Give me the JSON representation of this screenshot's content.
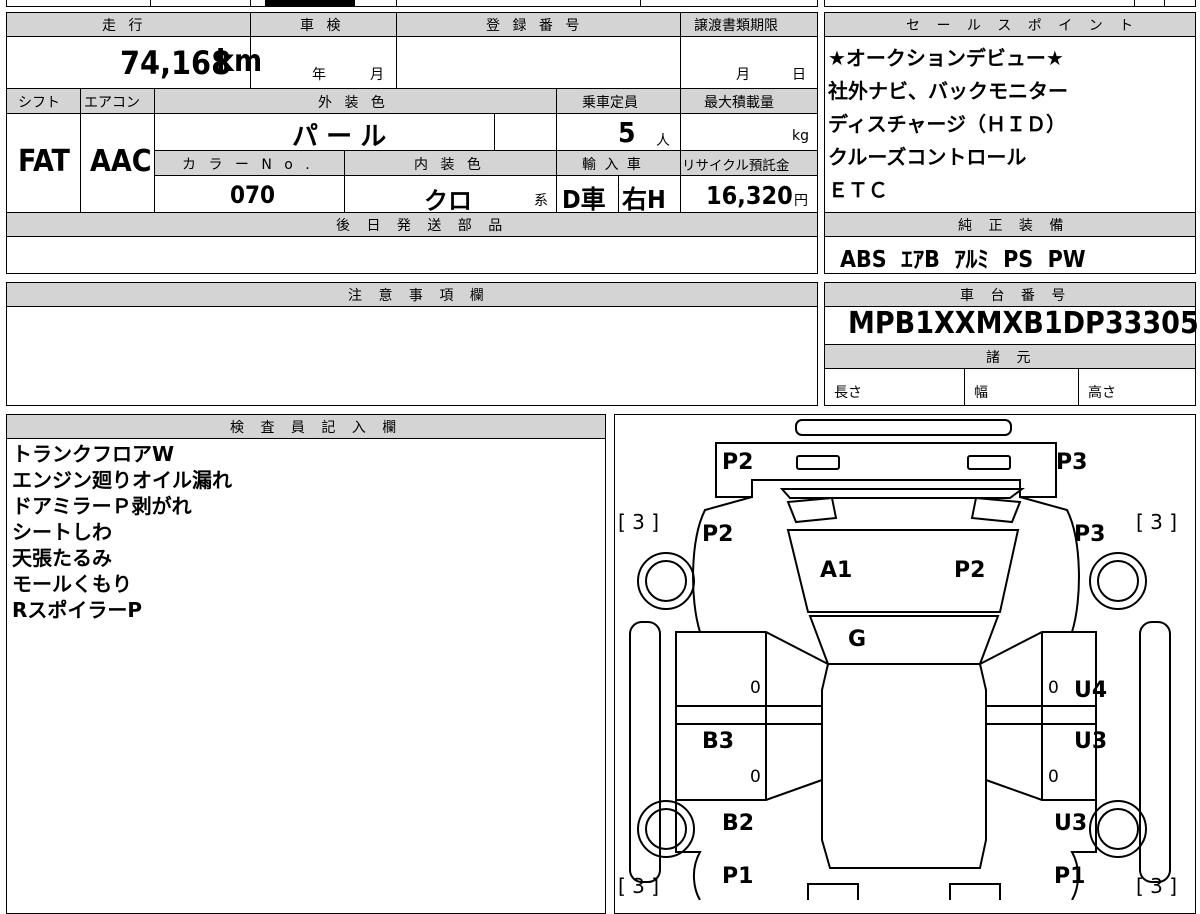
{
  "main": {
    "labels": {
      "mileage": "走 行",
      "inspection": "車 検",
      "registration": "登 録 番 号",
      "transfer_deadline": "譲渡書類期限",
      "shift": "シフト",
      "aircon": "エアコン",
      "exterior_color": "外 装 色",
      "capacity": "乗車定員",
      "max_load": "最大積載量",
      "color_no": "カ ラ ー N o .",
      "interior_color": "内 装 色",
      "import": "輸 入 車",
      "recycle_fee": "リサイクル預託金",
      "later_parts": "後 日 発 送 部 品",
      "notes": "注 意 事 項 欄",
      "inspector": "検 査 員 記 入 欄"
    },
    "values": {
      "mileage": "74,168",
      "mileage_unit": "km",
      "inspection_year": "年",
      "inspection_month": "月",
      "deadline_month": "月",
      "deadline_day": "日",
      "shift": "FAT",
      "aircon": "AAC",
      "exterior_color": "パ ー ル",
      "capacity": "5",
      "capacity_unit": "人",
      "load_unit": "kg",
      "color_no": "070",
      "interior_color": "クロ",
      "interior_suffix": "系",
      "import_drive": "D車",
      "import_handle": "右H",
      "recycle_fee": "16,320",
      "recycle_unit": "円"
    }
  },
  "sales": {
    "title": "セ ー ル ス ポ イ ン ト",
    "points": [
      "★オークションデビュー★",
      "社外ナビ、バックモニター",
      "ディスチャージ（ＨＩＤ）",
      "クルーズコントロール",
      "ＥＴＣ"
    ]
  },
  "equipment": {
    "title": "純 正 装 備",
    "items": "ABS  ｴｱB  ｱﾙﾐ  PS  PW"
  },
  "chassis": {
    "title": "車 台 番 号",
    "number": "MPB1XXMXB1DP33305",
    "specs_title": "諸 元",
    "length": "長さ",
    "width": "幅",
    "height": "高さ"
  },
  "inspector_notes": [
    "トランクフロアW",
    "エンジン廻りオイル漏れ",
    "ドアミラーＰ剥がれ",
    "シートしわ",
    "天張たるみ",
    "モールくもり",
    "RスポイラーP"
  ],
  "diagram": {
    "marks": {
      "p2_trunk": "P2",
      "p3_trunk": "P3",
      "p2_left": "P2",
      "p3_right": "P3",
      "a1": "A1",
      "p2_roof": "P2",
      "g": "G",
      "u4": "U4",
      "b3": "B3",
      "u3_right": "U3",
      "b2": "B2",
      "u3_lower": "U3",
      "p1_left": "P1",
      "p1_right": "P1",
      "tire_tl": "[ 3 ]",
      "tire_tr": "[ 3 ]",
      "tire_bl": "[ 3 ]",
      "tire_br": "[ 3 ]",
      "zero1": "0",
      "zero2": "0",
      "zero3": "0",
      "zero4": "0"
    }
  }
}
